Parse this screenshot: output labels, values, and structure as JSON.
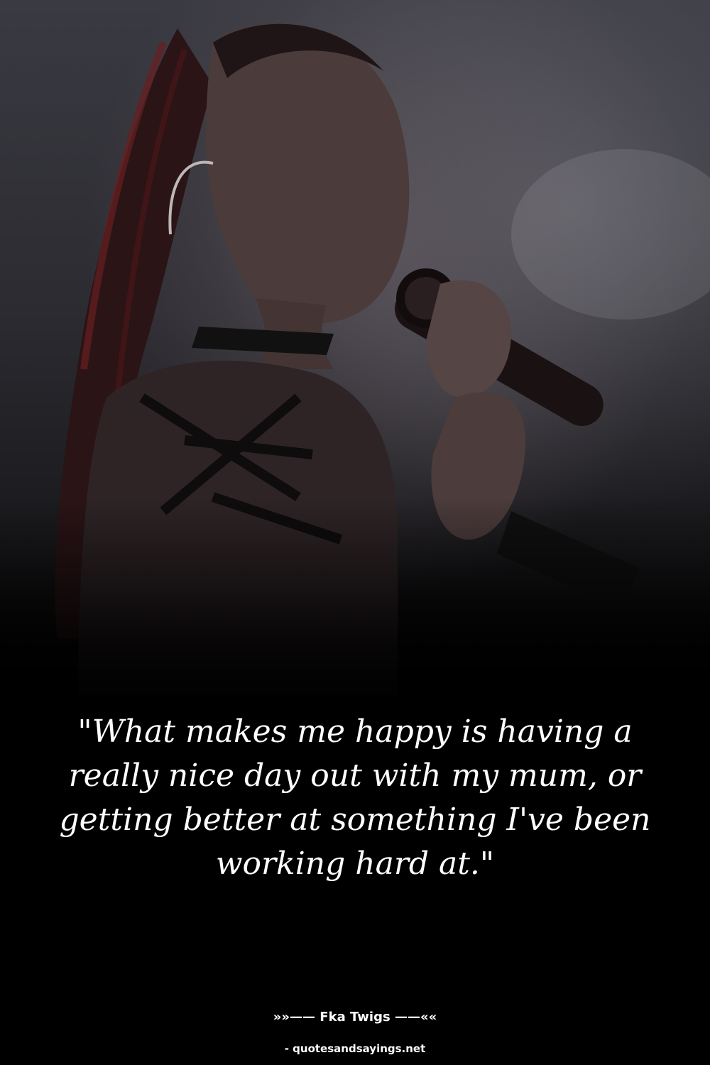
{
  "image": {
    "icon": "singer-with-microphone-photo",
    "palette": {
      "background": "#000000",
      "text": "#ffffff",
      "hair_accent": "#5a1a1c"
    }
  },
  "quote": {
    "text": "\"What makes me happy is having a really nice day out with my mum, or getting better at something I've been working hard at.\""
  },
  "author": {
    "line": "»»—— Fka Twigs ——««"
  },
  "source": {
    "text": "- quotesandsayings.net"
  }
}
